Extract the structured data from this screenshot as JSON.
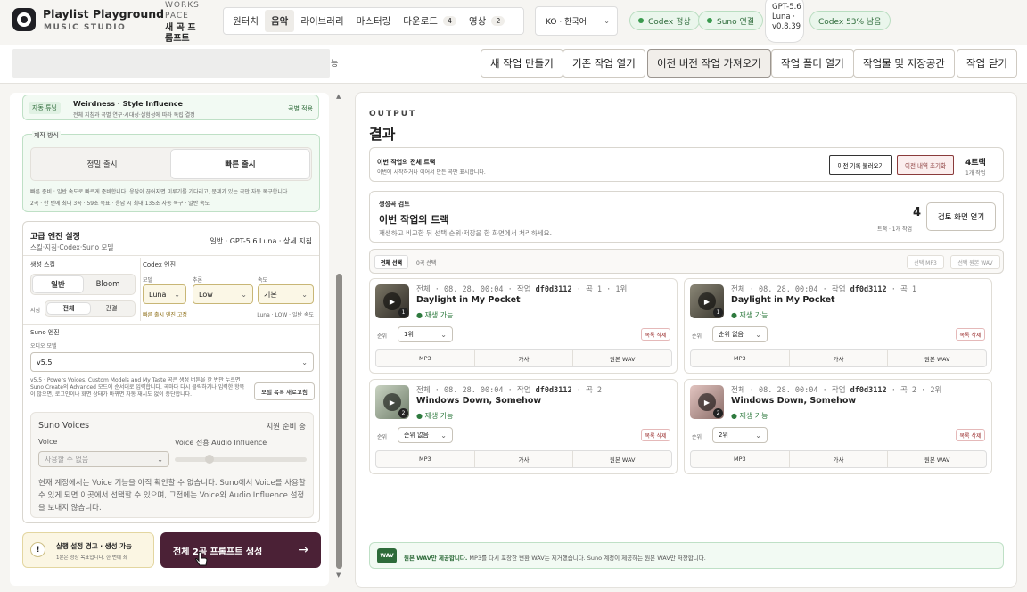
{
  "app": {
    "title": "Playlist Playground",
    "subtitle": "MUSIC STUDIO",
    "workspace_label": "WORKSPACE",
    "workspace_name": "새 곡 프롬프트"
  },
  "nav": {
    "tabs": [
      {
        "label": "원터치"
      },
      {
        "label": "음악"
      },
      {
        "label": "라이브러리"
      },
      {
        "label": "마스터링"
      },
      {
        "label": "다운로드",
        "count": "4"
      },
      {
        "label": "영상",
        "count": "2"
      }
    ],
    "active": "음악"
  },
  "language": {
    "value": "KO · 한국어"
  },
  "status": {
    "codex": "Codex 정상",
    "suno": "Suno 연결",
    "gpt": "GPT-5.6 Luna · v0.8.39",
    "quota": "Codex 53% 남음"
  },
  "toolbar": {
    "clipped_text": "능",
    "buttons": [
      "새 작업 만들기",
      "기존 작업 열기",
      "이전 버전 작업 가져오기",
      "작업 폴더 열기",
      "작업물 및 저장공간",
      "작업 닫기"
    ]
  },
  "left": {
    "auto_tuning": {
      "tag": "자동 튜닝",
      "title": "Weirdness · Style Influence",
      "desc": "전체 지침과 곡별 연구·시대성·실험성에 따라 독립 결정",
      "action": "곡별 적용"
    },
    "production": {
      "label": "제작 방식",
      "options": [
        "정밀 출시",
        "빠른 출시"
      ],
      "selected": "빠른 출시",
      "note1": "빠른 준비 : 일반 속도로 빠르게 준비합니다. 응답이 끊어지면 미루기를 기다리고, 문제가 있는 곡만 자동 복구합니다.",
      "note2": "2곡 · 한 번에 최대 3곡 · 59초 목표 · 응답 시 최대 135초 자동 복구 · 일반 속도"
    },
    "advanced": {
      "title": "고급 엔진 설정",
      "summary": "일반 · GPT-5.6 Luna · 상세 지침",
      "sub": "스킬·지침·Codex·Suno 모델"
    },
    "skill": {
      "label": "생성 스킬",
      "options": [
        "일반",
        "Bloom"
      ],
      "selected": "일반",
      "guide_label": "지침",
      "guide_options": [
        "전체",
        "간결"
      ],
      "guide_selected": "전체"
    },
    "codex": {
      "label": "Codex 엔진",
      "model_label": "모델",
      "model": "Luna",
      "effort_label": "추론",
      "effort": "Low",
      "speed_label": "속도",
      "speed": "기본",
      "fixed_note": "빠른 출시 엔진 고정",
      "summary": "Luna · LOW · 일반 속도"
    },
    "suno": {
      "label": "Suno 엔진",
      "audio_model_label": "오디오 모델",
      "audio_model": "v5.5",
      "note": "v5.5 · Powers Voices, Custom Models and My Taste 곡은 생성 버튼을 한 번만 누르면 Suno Create의 Advanced 모드에 순서대로 입력합니다. 곡마다 다시 클릭하거나 입력한 항목이 많으면, 로그인이나 화면 상태가 바뀌면 자동 재시도 없이 중단합니다.",
      "refresh": "모델 목록 새로고침"
    },
    "voices": {
      "title": "Suno Voices",
      "status": "지원 준비 중",
      "voice_label": "Voice",
      "voice_value": "사용할 수 없음",
      "influence_label": "Voice 전용 Audio Influence",
      "desc": "현재 계정에서는 Voice 기능을 아직 확인할 수 없습니다. Suno에서 Voice를 사용할 수 있게 되면 이곳에서 선택할 수 있으며, 그전에는 Voice와 Audio Influence 설정을 보내지 않습니다."
    },
    "warning": {
      "title": "실행 설정 경고 · 생성 가능",
      "desc": "1분은 정상 목표입니다. 한 번에 최"
    },
    "generate": {
      "label": "전체 2곡 프롬프트 생성",
      "arrow": "→"
    }
  },
  "output": {
    "eyebrow": "OUTPUT",
    "title": "결과",
    "all_tracks": {
      "label": "이번 작업의 전체 트랙",
      "desc": "이번에 시작하거나 이어서 만든 곡만 표시합니다.",
      "btn_load": "이전 기록 불러오기",
      "btn_reset": "이전 내역 초기화",
      "count": "4트랙",
      "count_sub": "1개 작업"
    },
    "review": {
      "tag": "생성곡 검토",
      "title": "이번 작업의 트랙",
      "desc": "재생하고 비교한 뒤 선택·순위·저장을 한 화면에서 처리하세요.",
      "count": "4",
      "count_sub": "트랙 · 1개 작업",
      "open": "검토 화면 열기"
    },
    "selection": {
      "select_all": "전체 선택",
      "selected": "0곡 선택",
      "mp3": "선택 MP3",
      "wav": "선택 원본 WAV"
    },
    "tracks": [
      {
        "meta_pre": "전체 · 08. 28. 00:04 · 작업 ",
        "id": "df0d3112",
        "meta_post": " · 곡 1 · 1위",
        "title": "Daylight in My Pocket",
        "status": "재생 가능",
        "rank_label": "순위",
        "rank": "1위",
        "delete": "목록 삭제",
        "badge": "1",
        "dl": [
          "MP3",
          "가사",
          "원본 WAV"
        ]
      },
      {
        "meta_pre": "전체 · 08. 28. 00:04 · 작업 ",
        "id": "df0d3112",
        "meta_post": " · 곡 1",
        "title": "Daylight in My Pocket",
        "status": "재생 가능",
        "rank_label": "순위",
        "rank": "순위 없음",
        "delete": "목록 삭제",
        "badge": "1",
        "dl": [
          "MP3",
          "가사",
          "원본 WAV"
        ]
      },
      {
        "meta_pre": "전체 · 08. 28. 00:04 · 작업 ",
        "id": "df0d3112",
        "meta_post": " · 곡 2",
        "title": "Windows Down, Somehow",
        "status": "재생 가능",
        "rank_label": "순위",
        "rank": "순위 없음",
        "delete": "목록 삭제",
        "badge": "2",
        "dl": [
          "MP3",
          "가사",
          "원본 WAV"
        ]
      },
      {
        "meta_pre": "전체 · 08. 28. 00:04 · 작업 ",
        "id": "df0d3112",
        "meta_post": " · 곡 2 · 2위",
        "title": "Windows Down, Somehow",
        "status": "재생 가능",
        "rank_label": "순위",
        "rank": "2위",
        "delete": "목록 삭제",
        "badge": "2",
        "dl": [
          "MP3",
          "가사",
          "원본 WAV"
        ]
      }
    ],
    "footer": {
      "tag": "WAV",
      "bold": "원본 WAV만 제공합니다.",
      "text": "MP3를 다시 포장한 변환 WAV는 제거했습니다. Suno 계정이 제공하는 원본 WAV만 저장합니다."
    }
  },
  "colors": {
    "accent": "#4b2136",
    "success": "#2e7a3e",
    "danger": "#9a2d2d",
    "warning_bg": "#fbf6e3"
  }
}
